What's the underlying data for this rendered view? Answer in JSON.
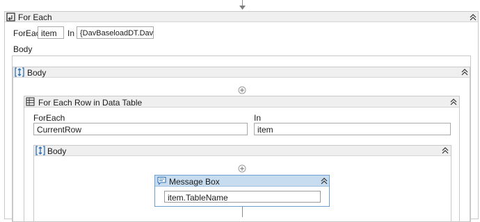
{
  "outer": {
    "title": "For Each",
    "foreach_label": "ForEach",
    "item_value": "item",
    "in_label": "In",
    "in_value": "{DavBaseloadDT.DavPeakl",
    "body_label": "Body"
  },
  "outer_body": {
    "title": "Body"
  },
  "data_table": {
    "title": "For Each Row in Data Table",
    "foreach_label": "ForEach",
    "foreach_value": "CurrentRow",
    "in_label": "In",
    "in_value": "item"
  },
  "inner_body": {
    "title": "Body"
  },
  "message_box": {
    "title": "Message Box",
    "value": "item.TableName"
  },
  "colors": {
    "accent": "#2f6fb3",
    "header_bg": "#efefef",
    "message_header_bg": "#c8dcf0",
    "border": "#c8c8c8"
  },
  "icons": {
    "outer": "for-each-icon",
    "body": "sequence-icon",
    "data_table": "data-table-icon",
    "message_box": "message-box-icon",
    "collapse": "chevron-up-double-icon",
    "add": "add-activity-icon"
  }
}
